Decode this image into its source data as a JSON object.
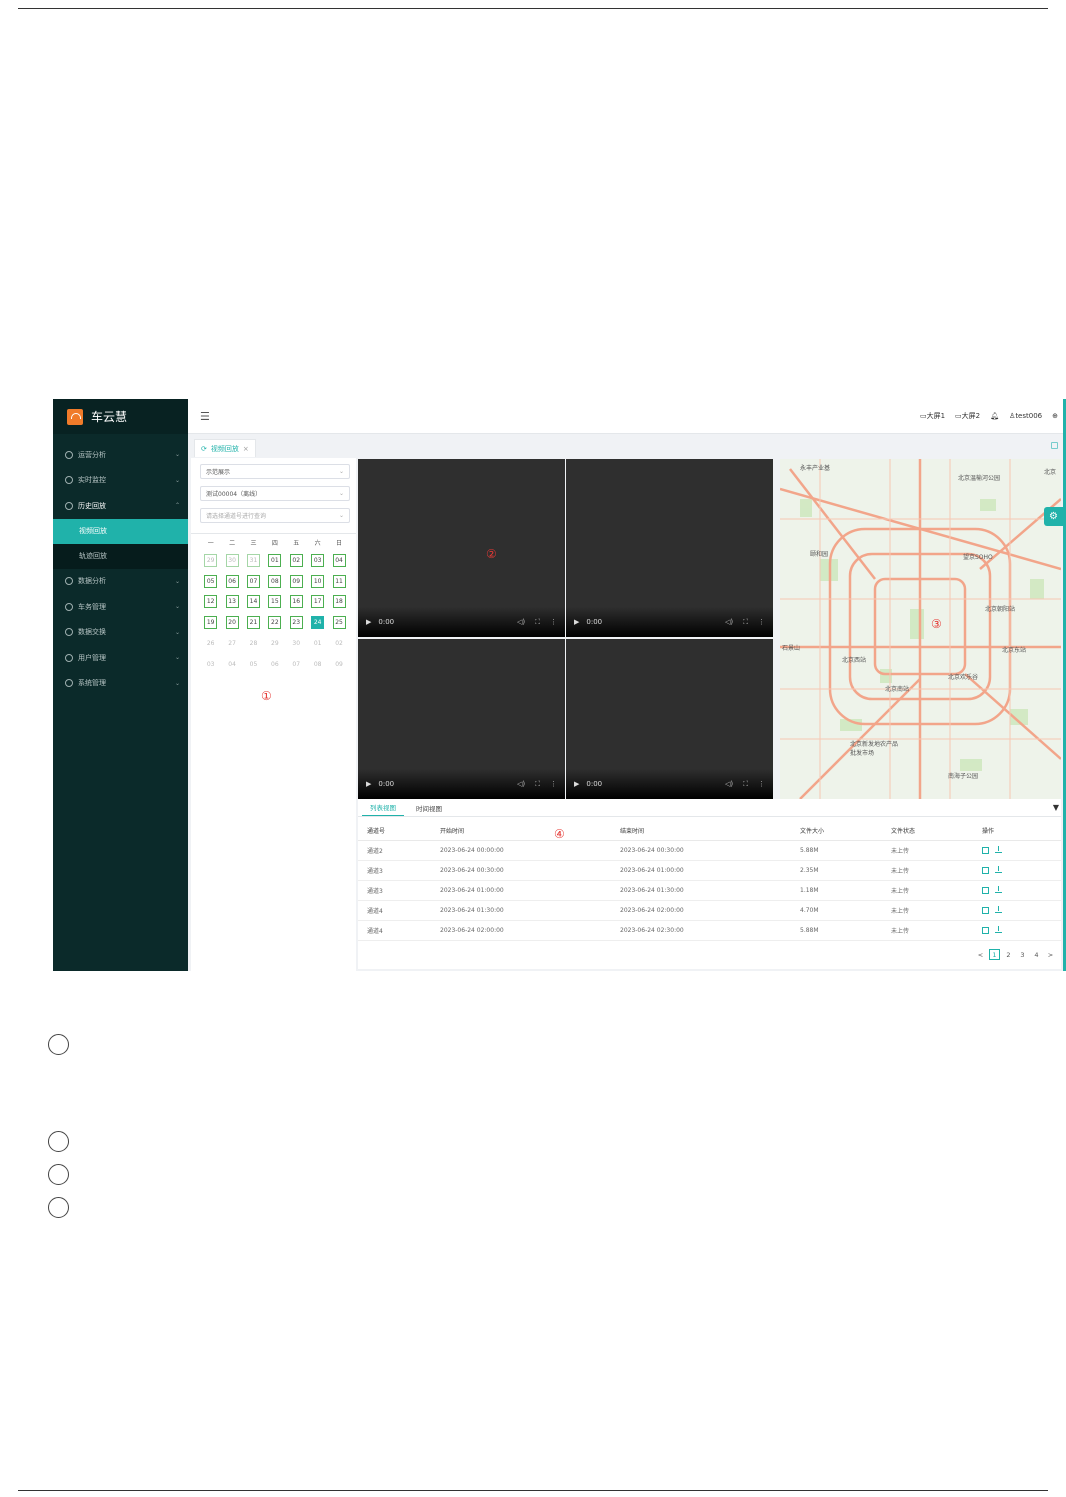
{
  "app": {
    "brand": "车云慧"
  },
  "sidebar": {
    "items": [
      {
        "label": "运营分析",
        "icon": "clock-icon"
      },
      {
        "label": "实时监控",
        "icon": "eye-icon"
      },
      {
        "label": "历史回放",
        "icon": "history-icon",
        "open": true
      },
      {
        "label": "数据分析",
        "icon": "chart-icon"
      },
      {
        "label": "车务管理",
        "icon": "grid-icon"
      },
      {
        "label": "数据交换",
        "icon": "doc-icon"
      },
      {
        "label": "用户管理",
        "icon": "user-icon"
      },
      {
        "label": "系统管理",
        "icon": "gear-icon"
      }
    ],
    "sub_items": [
      {
        "label": "视频回放",
        "active": true
      },
      {
        "label": "轨迹回放",
        "active": false
      }
    ]
  },
  "header": {
    "screen1": "大屏1",
    "screen2": "大屏2",
    "user": "test006"
  },
  "tab": {
    "label": "视频回放",
    "close": "×"
  },
  "query": {
    "org_select": "示范展示",
    "vehicle_select": "测试00004（离线）",
    "channel_placeholder": "请选择通道号进行查询"
  },
  "calendar": {
    "weekdays": [
      "一",
      "二",
      "三",
      "四",
      "五",
      "六",
      "日"
    ],
    "days": [
      {
        "d": "29",
        "s": "prev"
      },
      {
        "d": "30",
        "s": "prev"
      },
      {
        "d": "31",
        "s": "prev"
      },
      {
        "d": "01",
        "s": "has"
      },
      {
        "d": "02",
        "s": "has"
      },
      {
        "d": "03",
        "s": "has"
      },
      {
        "d": "04",
        "s": "has"
      },
      {
        "d": "05",
        "s": "has"
      },
      {
        "d": "06",
        "s": "has"
      },
      {
        "d": "07",
        "s": "has"
      },
      {
        "d": "08",
        "s": "has"
      },
      {
        "d": "09",
        "s": "has"
      },
      {
        "d": "10",
        "s": "has"
      },
      {
        "d": "11",
        "s": "has"
      },
      {
        "d": "12",
        "s": "has"
      },
      {
        "d": "13",
        "s": "has"
      },
      {
        "d": "14",
        "s": "has"
      },
      {
        "d": "15",
        "s": "has"
      },
      {
        "d": "16",
        "s": "has"
      },
      {
        "d": "17",
        "s": "has"
      },
      {
        "d": "18",
        "s": "has"
      },
      {
        "d": "19",
        "s": "has"
      },
      {
        "d": "20",
        "s": "has"
      },
      {
        "d": "21",
        "s": "has"
      },
      {
        "d": "22",
        "s": "has"
      },
      {
        "d": "23",
        "s": "has"
      },
      {
        "d": "24",
        "s": "sel-day"
      },
      {
        "d": "25",
        "s": "has"
      },
      {
        "d": "26",
        "s": "next"
      },
      {
        "d": "27",
        "s": "next"
      },
      {
        "d": "28",
        "s": "next"
      },
      {
        "d": "29",
        "s": "next"
      },
      {
        "d": "30",
        "s": "next"
      },
      {
        "d": "01",
        "s": "next"
      },
      {
        "d": "02",
        "s": "next"
      },
      {
        "d": "03",
        "s": "next"
      },
      {
        "d": "04",
        "s": "next"
      },
      {
        "d": "05",
        "s": "next"
      },
      {
        "d": "06",
        "s": "next"
      },
      {
        "d": "07",
        "s": "next"
      },
      {
        "d": "08",
        "s": "next"
      },
      {
        "d": "09",
        "s": "next"
      }
    ]
  },
  "annotations": {
    "a1": "①",
    "a2": "②",
    "a3": "③",
    "a4": "④"
  },
  "video": {
    "time": "0:00"
  },
  "map_labels": [
    "永丰产业基",
    "北京温榆河公园",
    "北京",
    "望京SOHO",
    "颐和园",
    "北京朝阳站",
    "石景山",
    "北京西站",
    "北京南站",
    "北京欢乐谷",
    "北京东站",
    "北京新发地农产品批发市场",
    "南海子公园"
  ],
  "records": {
    "tabs": [
      "列表视图",
      "时间视图"
    ],
    "columns": [
      "通道号",
      "开始时间",
      "结束时间",
      "文件大小",
      "文件状态",
      "操作"
    ],
    "rows": [
      [
        "通道2",
        "2023-06-24 00:00:00",
        "2023-06-24 00:30:00",
        "5.88M",
        "未上传"
      ],
      [
        "通道3",
        "2023-06-24 00:30:00",
        "2023-06-24 01:00:00",
        "2.35M",
        "未上传"
      ],
      [
        "通道3",
        "2023-06-24 01:00:00",
        "2023-06-24 01:30:00",
        "1.18M",
        "未上传"
      ],
      [
        "通道4",
        "2023-06-24 01:30:00",
        "2023-06-24 02:00:00",
        "4.70M",
        "未上传"
      ],
      [
        "通道4",
        "2023-06-24 02:00:00",
        "2023-06-24 02:30:00",
        "5.88M",
        "未上传"
      ]
    ],
    "pages": [
      "1",
      "2",
      "3",
      "4"
    ],
    "prev": "<",
    "next": ">"
  }
}
